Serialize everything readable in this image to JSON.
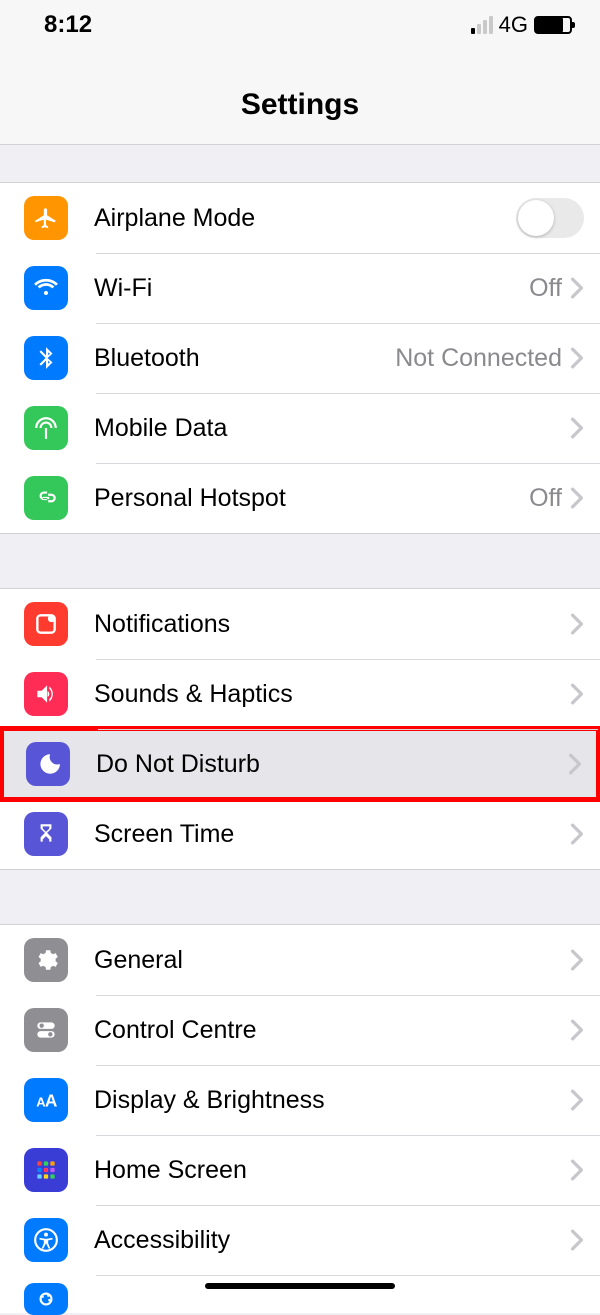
{
  "status": {
    "time": "8:12",
    "network": "4G"
  },
  "header": {
    "title": "Settings"
  },
  "rows": {
    "airplane": {
      "label": "Airplane Mode"
    },
    "wifi": {
      "label": "Wi-Fi",
      "value": "Off"
    },
    "bluetooth": {
      "label": "Bluetooth",
      "value": "Not Connected"
    },
    "mobiledata": {
      "label": "Mobile Data"
    },
    "hotspot": {
      "label": "Personal Hotspot",
      "value": "Off"
    },
    "notifications": {
      "label": "Notifications"
    },
    "sounds": {
      "label": "Sounds & Haptics"
    },
    "dnd": {
      "label": "Do Not Disturb"
    },
    "screentime": {
      "label": "Screen Time"
    },
    "general": {
      "label": "General"
    },
    "control": {
      "label": "Control Centre"
    },
    "display": {
      "label": "Display & Brightness"
    },
    "homescreen": {
      "label": "Home Screen"
    },
    "accessibility": {
      "label": "Accessibility"
    }
  }
}
